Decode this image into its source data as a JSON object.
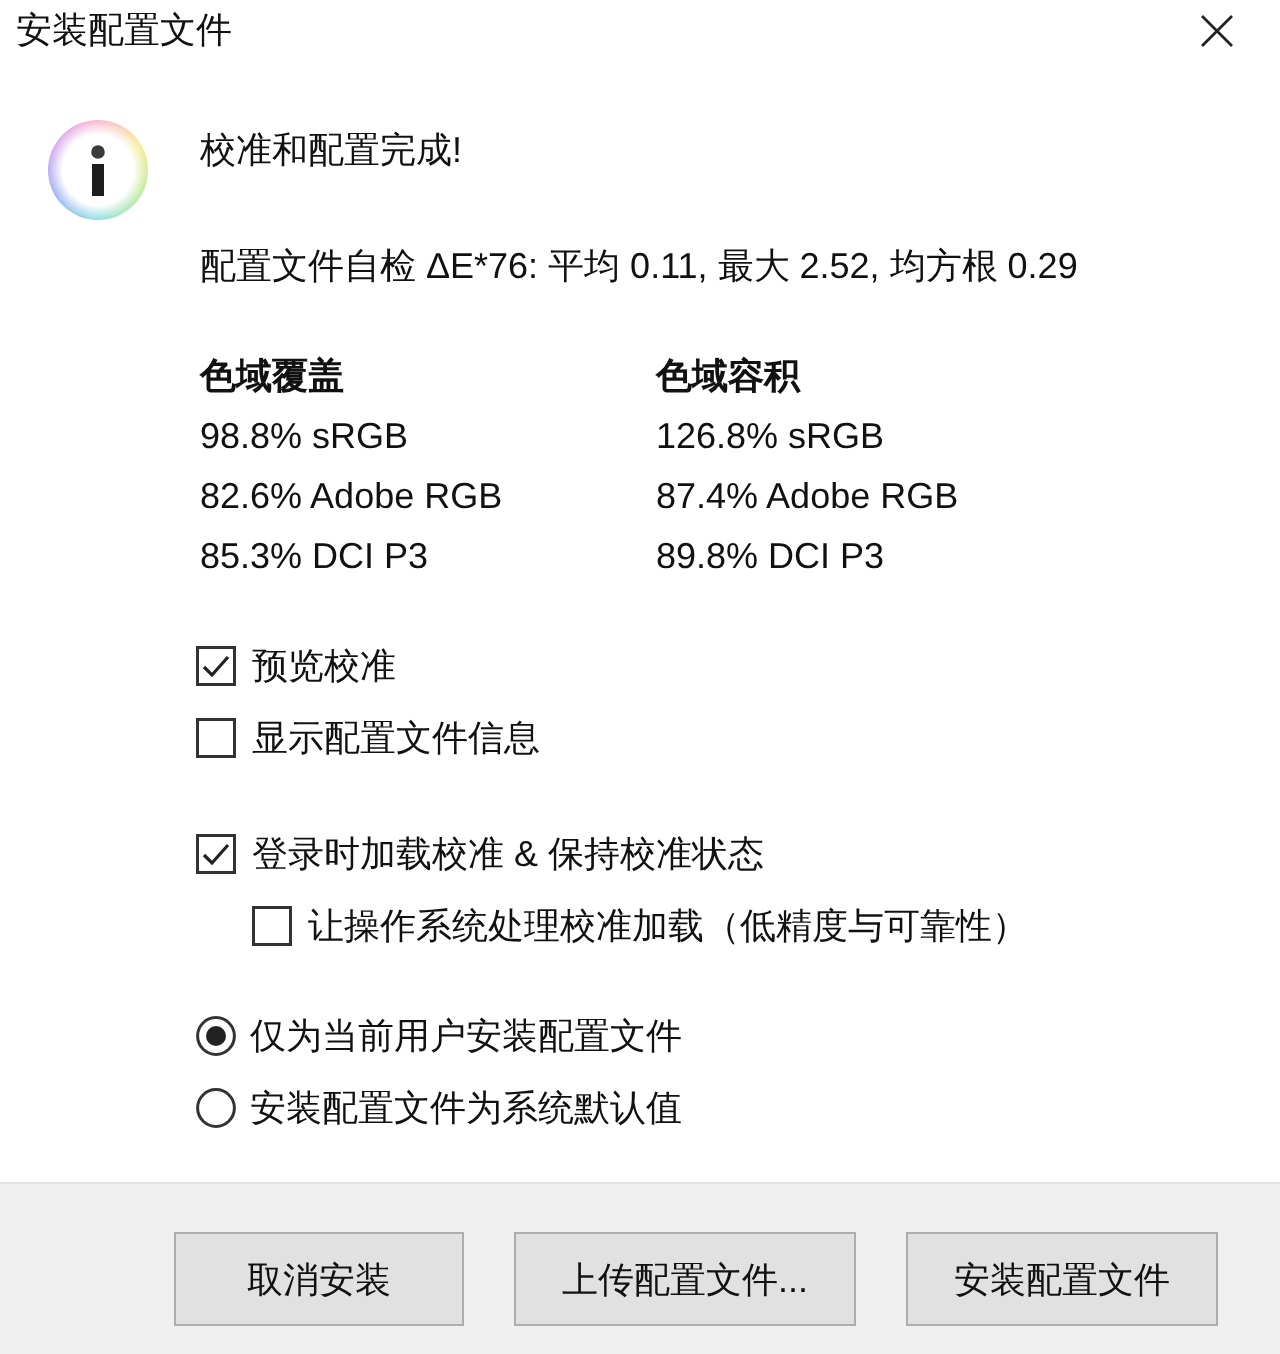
{
  "window": {
    "title": "安装配置文件"
  },
  "message": {
    "heading": "校准和配置完成!",
    "self_check": "配置文件自检 ΔE*76: 平均 0.11, 最大 2.52, 均方根 0.29"
  },
  "gamut": [
    {
      "heading": "色域覆盖",
      "rows": [
        "98.8% sRGB",
        "82.6% Adobe RGB",
        "85.3% DCI P3"
      ]
    },
    {
      "heading": "色域容积",
      "rows": [
        "126.8% sRGB",
        "87.4% Adobe RGB",
        "89.8% DCI P3"
      ]
    }
  ],
  "checkbox_groups": [
    [
      {
        "label": "预览校准",
        "checked": true
      },
      {
        "label": "显示配置文件信息",
        "checked": false
      }
    ],
    [
      {
        "label": "登录时加载校准 & 保持校准状态",
        "checked": true,
        "children": [
          {
            "label": "让操作系统处理校准加载（低精度与可靠性）",
            "checked": false
          }
        ]
      }
    ]
  ],
  "install_scope": [
    {
      "label": "仅为当前用户安装配置文件",
      "selected": true
    },
    {
      "label": "安装配置文件为系统默认值",
      "selected": false
    }
  ],
  "buttons": [
    "取消安装",
    "上传配置文件...",
    "安装配置文件"
  ]
}
